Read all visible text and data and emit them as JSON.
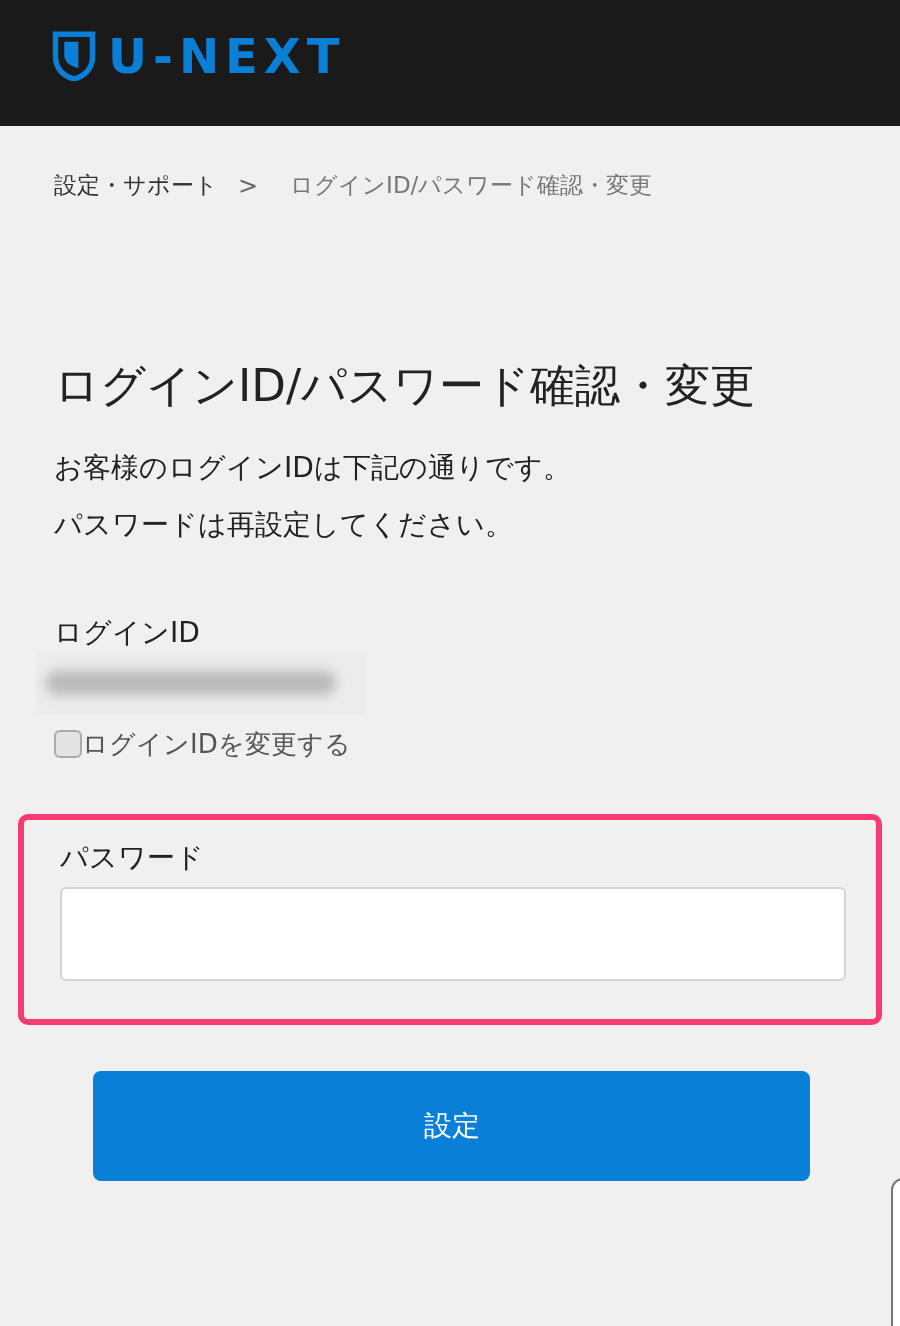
{
  "header": {
    "logo": "U-NEXT"
  },
  "breadcrumb": [
    {
      "label": "設定・サポート",
      "current": false
    },
    {
      "label": "ログインID/パスワード確認・変更",
      "current": true
    }
  ],
  "breadcrumb_separator": ">",
  "title": "ログインID/パスワード確認・変更",
  "description": [
    "お客様のログインIDは下記の通りです。",
    "パスワードは再設定してください。"
  ],
  "login_id": {
    "label": "ログインID"
  },
  "change_login_id": {
    "label": "ログインIDを変更する",
    "checked": false
  },
  "password": {
    "label": "パスワード",
    "highlighted": true
  },
  "submit_button": "設定"
}
